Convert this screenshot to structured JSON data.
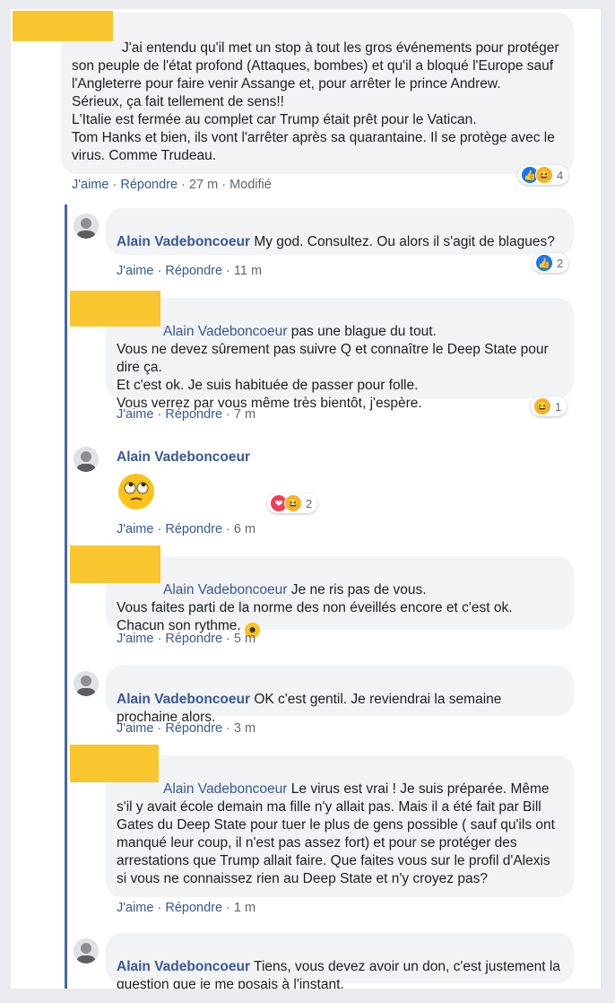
{
  "comments": [
    {
      "author": "",
      "text": "J'ai entendu qu'il met un stop à tout les gros événements pour protéger son peuple de l'état profond (Attaques, bombes) et qu'il a bloqué l'Europe sauf l'Angleterre pour faire venir Assange et, pour arrêter le prince Andrew.\nSérieux, ça fait tellement de sens!!\nL'Italie est fermée au complet car Trump était prêt pour le Vatican.\nTom Hanks et bien, ils vont l'arrêter après sa quarantaine. Il se protège avec le virus. Comme Trudeau.",
      "like": "J'aime",
      "reply": "Répondre",
      "time": "27 m",
      "edited": "Modifié",
      "reaction_count": "4",
      "reaction_icons": [
        "like",
        "haha"
      ]
    },
    {
      "author": "Alain Vadeboncoeur",
      "text": "My god. Consultez. Ou alors il s'agit de blagues?",
      "like": "J'aime",
      "reply": "Répondre",
      "time": "11 m",
      "reaction_count": "2",
      "reaction_icons": [
        "like"
      ]
    },
    {
      "mention": "Alain Vadeboncoeur",
      "text": "pas une blague du tout.\nVous ne devez sûrement pas suivre Q et connaître le Deep State pour dire ça.\nEt c'est ok. Je suis habituée de passer pour folle.\nVous verrez par vous même très bientôt, j'espère.",
      "like": "J'aime",
      "reply": "Répondre",
      "time": "7 m",
      "reaction_count": "1",
      "reaction_icons": [
        "haha"
      ]
    },
    {
      "author": "Alain Vadeboncoeur",
      "emoji": "eye-roll-emoji",
      "like": "J'aime",
      "reply": "Répondre",
      "time": "6 m",
      "reaction_count": "2",
      "reaction_icons": [
        "love",
        "haha"
      ]
    },
    {
      "mention": "Alain Vadeboncoeur",
      "text": "Je ne ris pas de vous.\nVous faites parti de la norme des non éveillés encore et c'est ok. Chacun son rythme.",
      "like": "J'aime",
      "reply": "Répondre",
      "time": "5 m"
    },
    {
      "author": "Alain Vadeboncoeur",
      "text": "OK c'est gentil. Je reviendrai la semaine prochaine alors.",
      "like": "J'aime",
      "reply": "Répondre",
      "time": "3 m"
    },
    {
      "mention": "Alain Vadeboncoeur",
      "text": "Le virus est vrai ! Je suis préparée. Même s'il y avait école demain ma fille n'y allait pas. Mais il a été fait par Bill Gates du Deep State pour tuer le plus de gens possible ( sauf qu'ils ont manqué leur coup, il n'est pas assez fort) et pour se protéger des arrestations que Trump allait faire. Que faites vous sur le profil d'Alexis si vous ne connaissez rien au Deep State et n'y croyez pas?",
      "like": "J'aime",
      "reply": "Répondre",
      "time": "1 m"
    },
    {
      "author": "Alain Vadeboncoeur",
      "text": "Tiens, vous devez avoir un don, c'est justement la question que je me posais à l'instant."
    }
  ],
  "separator": " · ",
  "colors": {
    "link": "#385898",
    "bubble": "#f2f3f5",
    "redaction": "#f9c630",
    "thread_line": "#4267b2"
  }
}
